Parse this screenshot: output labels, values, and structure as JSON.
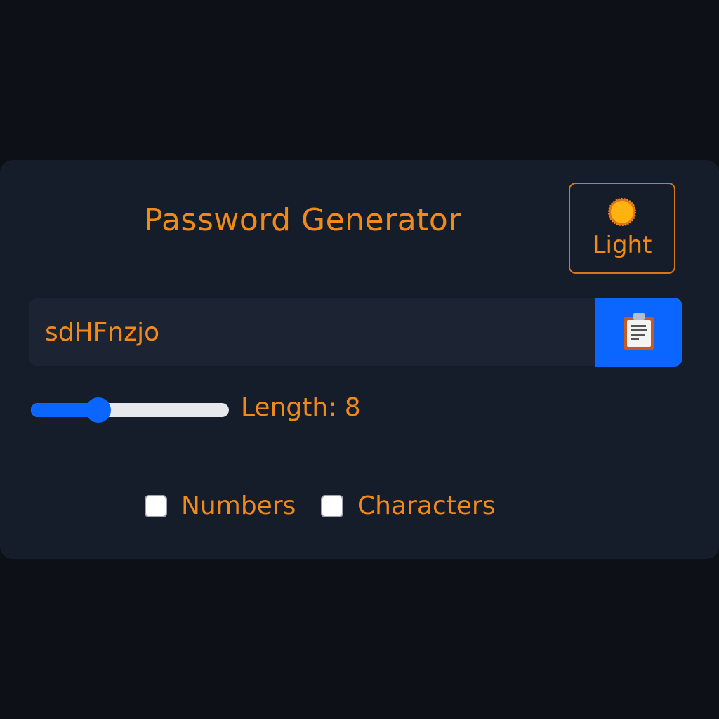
{
  "app": {
    "title": "Password Generator"
  },
  "theme_toggle": {
    "icon": "sun-icon",
    "label": "Light"
  },
  "password": {
    "value": "sdHFnzjo"
  },
  "copy_button": {
    "icon": "clipboard-icon"
  },
  "length_slider": {
    "fill_fraction": 0.34,
    "label": "Length: 8"
  },
  "options": [
    {
      "label": "Numbers",
      "checked": false
    },
    {
      "label": "Characters",
      "checked": false
    }
  ],
  "colors": {
    "background": "#0d1117",
    "card": "#161d2a",
    "accent_text": "#f28a19",
    "primary_blue": "#0b66ff"
  }
}
